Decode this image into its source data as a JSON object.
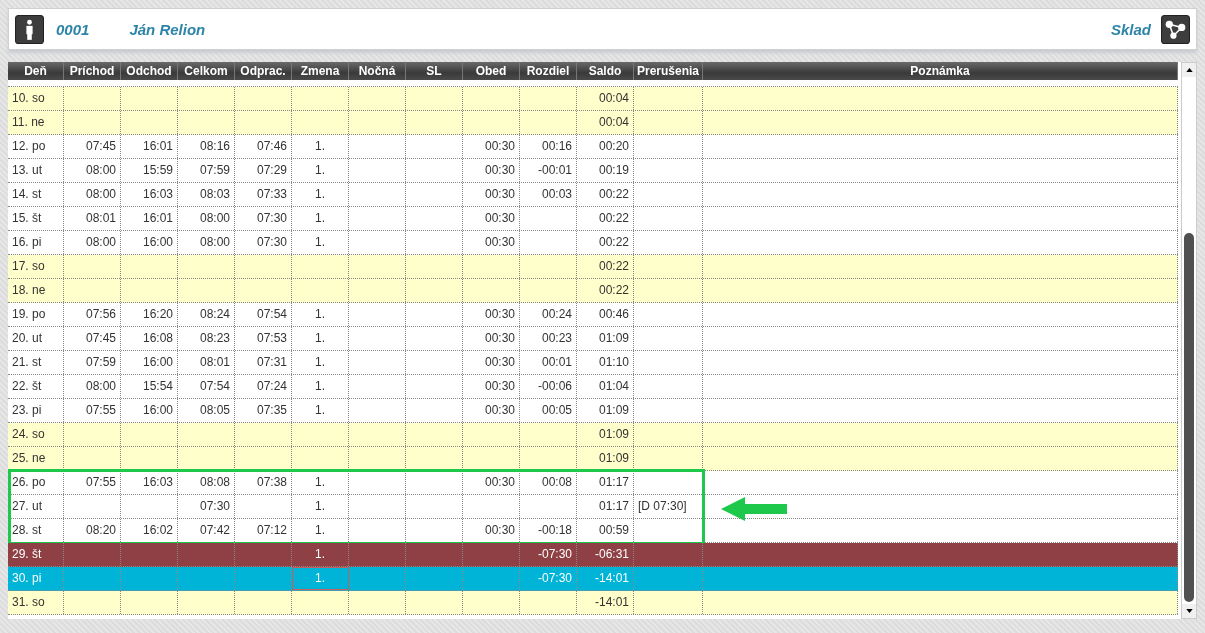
{
  "header": {
    "employee_id": "0001",
    "employee_name": "Ján Relion",
    "department": "Sklad"
  },
  "table": {
    "columns": [
      "Deň",
      "Príchod",
      "Odchod",
      "Celkom",
      "Odprac.",
      "Zmena",
      "Nočná",
      "SL",
      "Obed",
      "Rozdiel",
      "Saldo",
      "Prerušenia",
      "Poznámka"
    ],
    "rows": [
      {
        "kind": "weekend",
        "selected": false,
        "highlighted": false,
        "cells": [
          "10. so",
          null,
          null,
          null,
          null,
          null,
          null,
          null,
          null,
          null,
          "00:04"
        ]
      },
      {
        "kind": "weekend",
        "selected": false,
        "highlighted": false,
        "cells": [
          "11. ne",
          null,
          null,
          null,
          null,
          null,
          null,
          null,
          null,
          null,
          "00:04"
        ]
      },
      {
        "kind": "workday",
        "selected": false,
        "highlighted": false,
        "cells": [
          "12. po",
          "07:45",
          "16:01",
          "08:16",
          "07:46",
          "1.",
          null,
          null,
          "00:30",
          "00:16",
          "00:20"
        ]
      },
      {
        "kind": "workday",
        "selected": false,
        "highlighted": false,
        "cells": [
          "13. ut",
          "08:00",
          "15:59",
          "07:59",
          "07:29",
          "1.",
          null,
          null,
          "00:30",
          "-00:01",
          "00:19"
        ]
      },
      {
        "kind": "workday",
        "selected": false,
        "highlighted": false,
        "cells": [
          "14. st",
          "08:00",
          "16:03",
          "08:03",
          "07:33",
          "1.",
          null,
          null,
          "00:30",
          "00:03",
          "00:22"
        ]
      },
      {
        "kind": "workday",
        "selected": false,
        "highlighted": false,
        "cells": [
          "15. št",
          "08:01",
          "16:01",
          "08:00",
          "07:30",
          "1.",
          null,
          null,
          "00:30",
          null,
          "00:22"
        ]
      },
      {
        "kind": "workday",
        "selected": false,
        "highlighted": false,
        "cells": [
          "16. pi",
          "08:00",
          "16:00",
          "08:00",
          "07:30",
          "1.",
          null,
          null,
          "00:30",
          null,
          "00:22"
        ]
      },
      {
        "kind": "weekend",
        "selected": false,
        "highlighted": false,
        "cells": [
          "17. so",
          null,
          null,
          null,
          null,
          null,
          null,
          null,
          null,
          null,
          "00:22"
        ]
      },
      {
        "kind": "weekend",
        "selected": false,
        "highlighted": false,
        "cells": [
          "18. ne",
          null,
          null,
          null,
          null,
          null,
          null,
          null,
          null,
          null,
          "00:22"
        ]
      },
      {
        "kind": "workday",
        "selected": false,
        "highlighted": false,
        "cells": [
          "19. po",
          "07:56",
          "16:20",
          "08:24",
          "07:54",
          "1.",
          null,
          null,
          "00:30",
          "00:24",
          "00:46"
        ]
      },
      {
        "kind": "workday",
        "selected": false,
        "highlighted": false,
        "cells": [
          "20. ut",
          "07:45",
          "16:08",
          "08:23",
          "07:53",
          "1.",
          null,
          null,
          "00:30",
          "00:23",
          "01:09"
        ]
      },
      {
        "kind": "workday",
        "selected": false,
        "highlighted": false,
        "cells": [
          "21. st",
          "07:59",
          "16:00",
          "08:01",
          "07:31",
          "1.",
          null,
          null,
          "00:30",
          "00:01",
          "01:10"
        ]
      },
      {
        "kind": "workday",
        "selected": false,
        "highlighted": false,
        "cells": [
          "22. št",
          "08:00",
          "15:54",
          "07:54",
          "07:24",
          "1.",
          null,
          null,
          "00:30",
          "-00:06",
          "01:04"
        ]
      },
      {
        "kind": "workday",
        "selected": false,
        "highlighted": false,
        "cells": [
          "23. pi",
          "07:55",
          "16:00",
          "08:05",
          "07:35",
          "1.",
          null,
          null,
          "00:30",
          "00:05",
          "01:09"
        ]
      },
      {
        "kind": "weekend",
        "selected": false,
        "highlighted": false,
        "cells": [
          "24. so",
          null,
          null,
          null,
          null,
          null,
          null,
          null,
          null,
          null,
          "01:09"
        ]
      },
      {
        "kind": "weekend",
        "selected": false,
        "highlighted": false,
        "cells": [
          "25. ne",
          null,
          null,
          null,
          null,
          null,
          null,
          null,
          null,
          null,
          "01:09"
        ]
      },
      {
        "kind": "workday",
        "selected": false,
        "highlighted": true,
        "cells": [
          "26. po",
          "07:55",
          "16:03",
          "08:08",
          "07:38",
          "1.",
          null,
          null,
          "00:30",
          "00:08",
          "01:17"
        ]
      },
      {
        "kind": "workday",
        "selected": false,
        "highlighted": true,
        "cells": [
          "27. ut",
          null,
          null,
          "07:30",
          null,
          "1.",
          null,
          null,
          null,
          null,
          "01:17",
          "[D 07:30]"
        ]
      },
      {
        "kind": "workday",
        "selected": false,
        "highlighted": true,
        "cells": [
          "28. st",
          "08:20",
          "16:02",
          "07:42",
          "07:12",
          "1.",
          null,
          null,
          "00:30",
          "-00:18",
          "00:59"
        ]
      },
      {
        "kind": "absence",
        "selected": false,
        "highlighted": false,
        "cells": [
          "29. št",
          null,
          null,
          null,
          null,
          "1.",
          null,
          null,
          null,
          "-07:30",
          "-06:31"
        ]
      },
      {
        "kind": "workday",
        "selected": true,
        "highlighted": false,
        "cells": [
          "30. pi",
          null,
          null,
          null,
          null,
          "1.",
          null,
          null,
          null,
          "-07:30",
          "-14:01"
        ]
      },
      {
        "kind": "weekend",
        "selected": false,
        "highlighted": false,
        "cells": [
          "31. so",
          null,
          null,
          null,
          null,
          null,
          null,
          null,
          null,
          null,
          "-14:01"
        ]
      }
    ]
  }
}
